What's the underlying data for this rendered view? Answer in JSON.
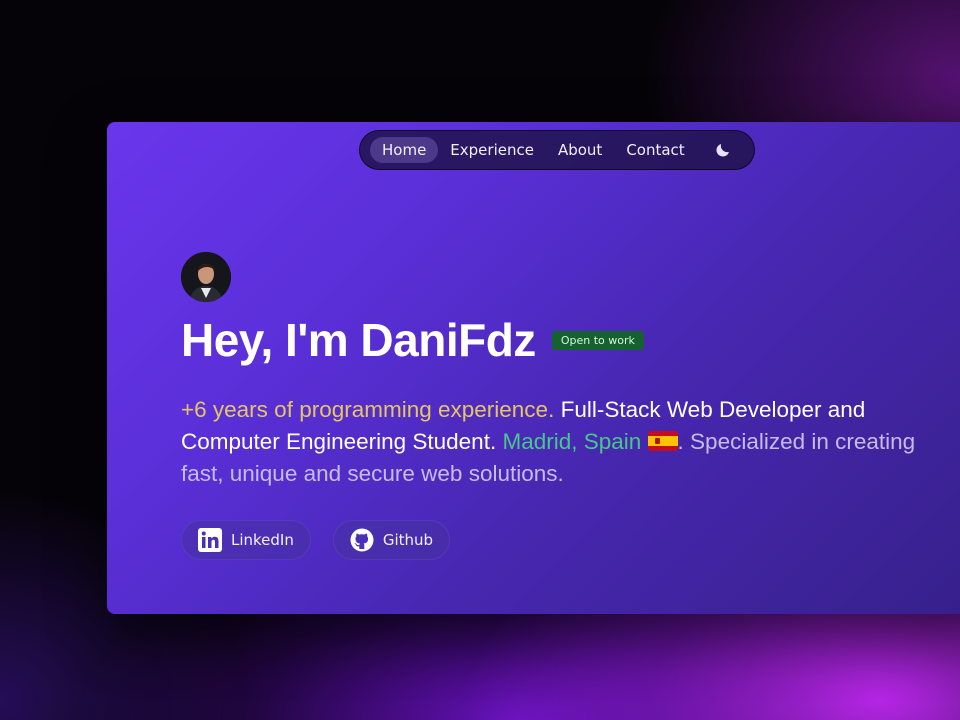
{
  "nav": {
    "items": [
      {
        "label": "Home",
        "active": true
      },
      {
        "label": "Experience",
        "active": false
      },
      {
        "label": "About",
        "active": false
      },
      {
        "label": "Contact",
        "active": false
      }
    ],
    "theme_toggle_icon": "moon-icon"
  },
  "hero": {
    "greeting": "Hey, I'm DaniFdz",
    "status_badge": "Open to work",
    "description": {
      "years": "+6 years of programming experience.",
      "role": " Full-Stack Web Developer and Computer Engineering Student. ",
      "location": "Madrid, Spain",
      "location_flag_icon": "spain-flag-icon",
      "specialized": ". Specialized in creating fast, unique and secure web solutions."
    }
  },
  "social": {
    "linkedin_label": "LinkedIn",
    "github_label": "Github"
  },
  "colors": {
    "accent_years": "#e5c666",
    "accent_location": "#46c88a",
    "badge_bg": "#15612f",
    "card_gradient_start": "#6a36ec",
    "card_gradient_end": "#36208a"
  }
}
